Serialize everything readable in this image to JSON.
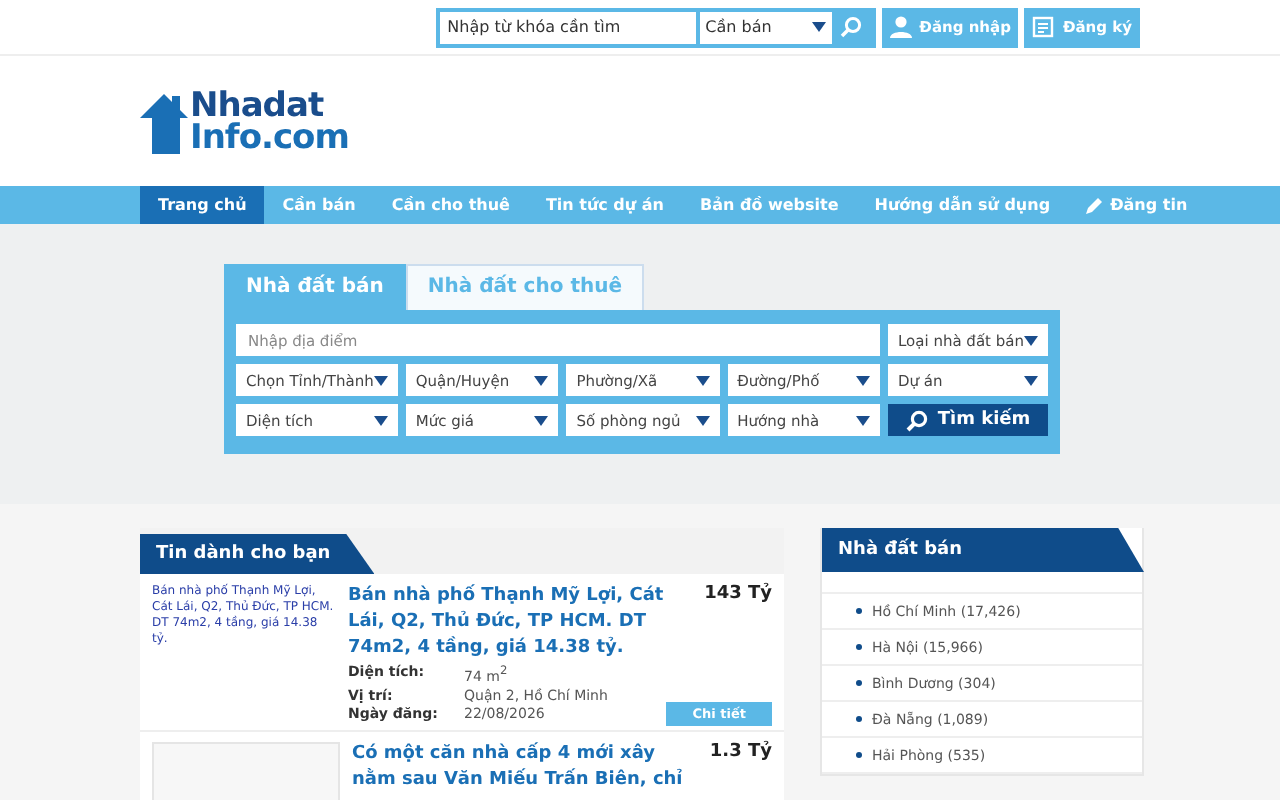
{
  "top_bar": {
    "search": {
      "placeholder": "Nhập từ khóa cần tìm"
    },
    "category": "Cần bán",
    "buttons": [
      {
        "kind": "login",
        "label": "Đăng nhập"
      },
      {
        "kind": "register",
        "label": "Đăng ký"
      }
    ]
  },
  "logo": {
    "line_1": "Nhadat",
    "line_2": "Info.com"
  },
  "nav": [
    {
      "label": "Trang chủ",
      "selected": true,
      "kind": "link"
    },
    {
      "label": "Cần bán",
      "selected": false,
      "kind": "link"
    },
    {
      "label": "Cần cho thuê",
      "selected": false,
      "kind": "link"
    },
    {
      "label": "Tin tức dự án",
      "selected": false,
      "kind": "link"
    },
    {
      "label": "Bản đồ website",
      "selected": false,
      "kind": "link"
    },
    {
      "label": "Hướng dẫn sử dụng",
      "selected": false,
      "kind": "link"
    },
    {
      "label": "Đăng tin",
      "selected": false,
      "kind": "post"
    }
  ],
  "search_panel": {
    "tabs": [
      {
        "label": "Nhà đất bán",
        "selected": true
      },
      {
        "label": "Nhà đất cho thuê",
        "selected": false
      }
    ],
    "location": {
      "placeholder": "Nhập địa điểm"
    },
    "type_filter": "Loại nhà đất bán",
    "filters": [
      [
        "Chọn Tỉnh/Thành",
        "Quận/Huyện",
        "Phường/Xã",
        "Đường/Phố",
        "Dự án"
      ],
      [
        "Diện tích",
        "Mức giá",
        "Số phòng ngủ",
        "Hướng nhà"
      ]
    ],
    "button": "Tìm kiếm"
  },
  "listings": {
    "title": "Tin dành cho bạn",
    "items": [
      {
        "image": {
          "kind": "broken",
          "alt": "Bán nhà phố Thạnh Mỹ Lợi, Cát Lái, Q2, Thủ Đức, TP HCM. DT 74m2, 4 tầng, giá 14.38 tỷ."
        },
        "title": "Bán nhà phố Thạnh Mỹ Lợi, Cát Lái, Q2, Thủ Đức, TP HCM. DT 74m2, 4 tầng, giá 14.38 tỷ.",
        "price": "143 Tỷ",
        "details": [
          {
            "label": "Diện tích:",
            "value": "74 m$^{2}$"
          },
          {
            "label": "Vị trí:",
            "value": "Quận 2, Hồ Chí Minh"
          },
          {
            "label": "Ngày đăng:",
            "value": "22/08/2026"
          }
        ],
        "button": "Chi tiết"
      },
      {
        "image": {
          "kind": "photo"
        },
        "title": "Có một căn nhà cấp 4 mới xây nằm sau Văn Miếu Trấn Biên, chỉ",
        "price": "1.3 Tỷ"
      }
    ]
  },
  "sidebar": {
    "title": "Nhà đất bán",
    "items": [
      "Hồ Chí Minh (17,426)",
      "Hà Nội (15,966)",
      "Bình Dương (304)",
      "Đà Nẵng (1,089)",
      "Hải Phòng (535)"
    ]
  }
}
